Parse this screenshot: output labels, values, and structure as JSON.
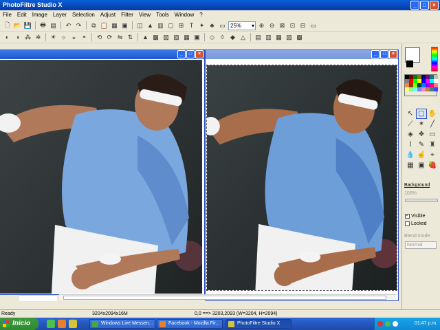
{
  "app": {
    "title": "PhotoFiltre Studio X"
  },
  "menu": [
    "File",
    "Edit",
    "Image",
    "Layer",
    "Selection",
    "Adjust",
    "Filter",
    "View",
    "Tools",
    "Window",
    "?"
  ],
  "toolbar": {
    "zoom_value": "25%"
  },
  "panel": {
    "layer_name": "Background",
    "opacity": "100%",
    "visible_label": "Visible",
    "locked_label": "Locked",
    "blend_label": "Blend mode",
    "blend_value": "Normal",
    "visible_checked": true,
    "locked_checked": false
  },
  "status": {
    "ready": "Ready",
    "image_size": "3204x2094x16M",
    "coords": "0,0 ==> 3203,2093 (W=3204, H=2094)"
  },
  "taskbar": {
    "start_label": "Inicio",
    "tasks": [
      {
        "label": "Windows Live Messen...",
        "active": false,
        "icon_color": "#45a845"
      },
      {
        "label": "Facebook - Mozilla Fir...",
        "active": false,
        "icon_color": "#e8822a"
      },
      {
        "label": "PhotoFiltre Studio X",
        "active": true,
        "icon_color": "#d8c43a"
      }
    ],
    "clock": "01:47 p.m."
  },
  "colors": {
    "accent": "#0a5fd8",
    "taskbar": "#2457c0",
    "start": "#3c9a3c"
  }
}
